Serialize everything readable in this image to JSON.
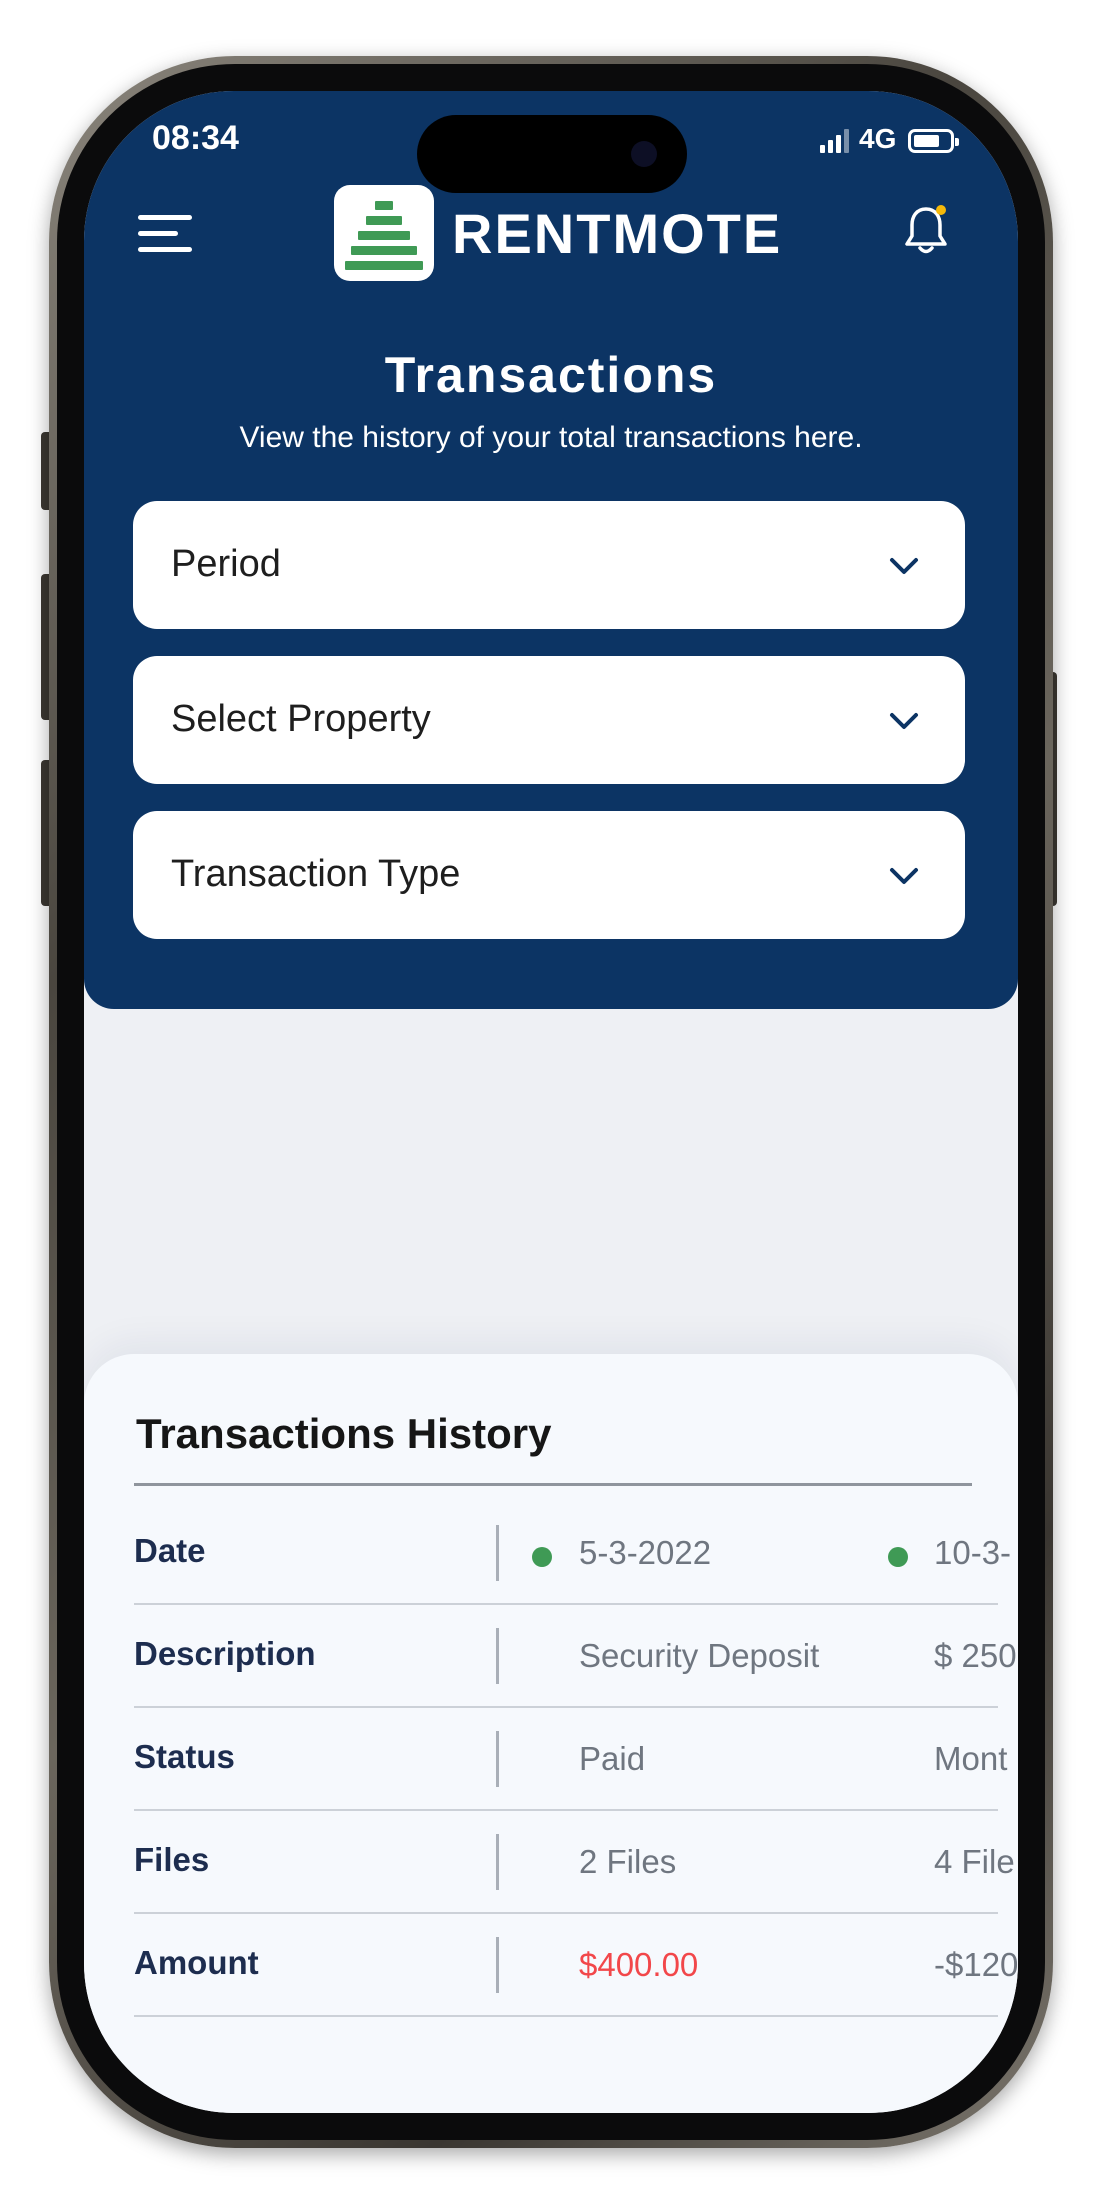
{
  "status_bar": {
    "time": "08:34",
    "network": "4G"
  },
  "header": {
    "brand": "RENTMOTE",
    "title": "Transactions",
    "subtitle": "View the history of your total transactions here."
  },
  "filters": {
    "period": "Period",
    "property": "Select Property",
    "transaction_type": "Transaction Type"
  },
  "history": {
    "title": "Transactions History",
    "rows": {
      "date": {
        "label": "Date",
        "col1": "5-3-2022",
        "col2": "10-3-"
      },
      "description": {
        "label": "Description",
        "col1": "Security Deposit",
        "col2": "$ 250"
      },
      "status": {
        "label": "Status",
        "col1": "Paid",
        "col2": "Mont"
      },
      "files": {
        "label": "Files",
        "col1": "2 Files",
        "col2": "4 File"
      },
      "amount": {
        "label": "Amount",
        "col1": "$400.00",
        "col2": "-$120"
      }
    }
  },
  "colors": {
    "header_bg": "#0c3464",
    "accent_green": "#3f9a55",
    "amount_red": "#f2474a",
    "notification_dot": "#f5b90a"
  }
}
